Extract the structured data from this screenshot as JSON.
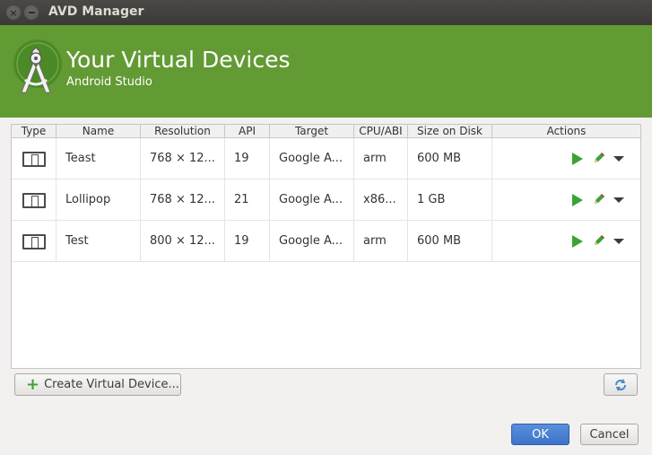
{
  "window": {
    "title": "AVD Manager"
  },
  "banner": {
    "title": "Your Virtual Devices",
    "subtitle": "Android Studio",
    "color": "#629a34"
  },
  "table": {
    "headers": [
      "Type",
      "Name",
      "Resolution",
      "API",
      "Target",
      "CPU/ABI",
      "Size on Disk",
      "Actions"
    ],
    "rows": [
      {
        "name": "Teast",
        "resolution": "768 × 12...",
        "api": "19",
        "target": "Google A...",
        "cpu": "arm",
        "size": "600 MB"
      },
      {
        "name": "Lollipop",
        "resolution": "768 × 12...",
        "api": "21",
        "target": "Google A...",
        "cpu": "x86...",
        "size": "1 GB"
      },
      {
        "name": "Test",
        "resolution": "800 × 12...",
        "api": "19",
        "target": "Google A...",
        "cpu": "arm",
        "size": "600 MB"
      }
    ]
  },
  "buttons": {
    "create": "Create Virtual Device...",
    "ok": "OK",
    "cancel": "Cancel"
  },
  "icons": {
    "type": "phone-icon",
    "run": "play-icon",
    "edit": "pencil-icon",
    "menu": "chevron-down-icon",
    "refresh": "refresh-icon",
    "add": "plus-icon"
  },
  "colors": {
    "accent": "#3aa335",
    "primary": "#3d73c9"
  }
}
